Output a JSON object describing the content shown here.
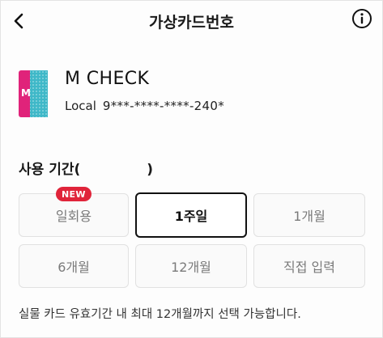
{
  "header": {
    "title": "가상카드번호",
    "back_icon": "chevron-left-icon",
    "info_icon": "info-circle-icon"
  },
  "card": {
    "name": "M CHECK",
    "type_label": "Local",
    "masked_number": "9***-****-****-240*",
    "image_colors": [
      "#e0237a",
      "#3fb8c8"
    ]
  },
  "usage": {
    "label": "사용 기간(",
    "label_suffix": ")",
    "selected": "1주일",
    "options": [
      {
        "label": "일회용",
        "badge": "NEW"
      },
      {
        "label": "1주일"
      },
      {
        "label": "1개월"
      },
      {
        "label": "6개월"
      },
      {
        "label": "12개월"
      },
      {
        "label": "직접 입력"
      }
    ]
  },
  "note": "실물 카드 유효기간 내 최대 12개월까지 선택 가능합니다.",
  "colors": {
    "accent_badge": "#e0243a",
    "selected_border": "#111111"
  }
}
